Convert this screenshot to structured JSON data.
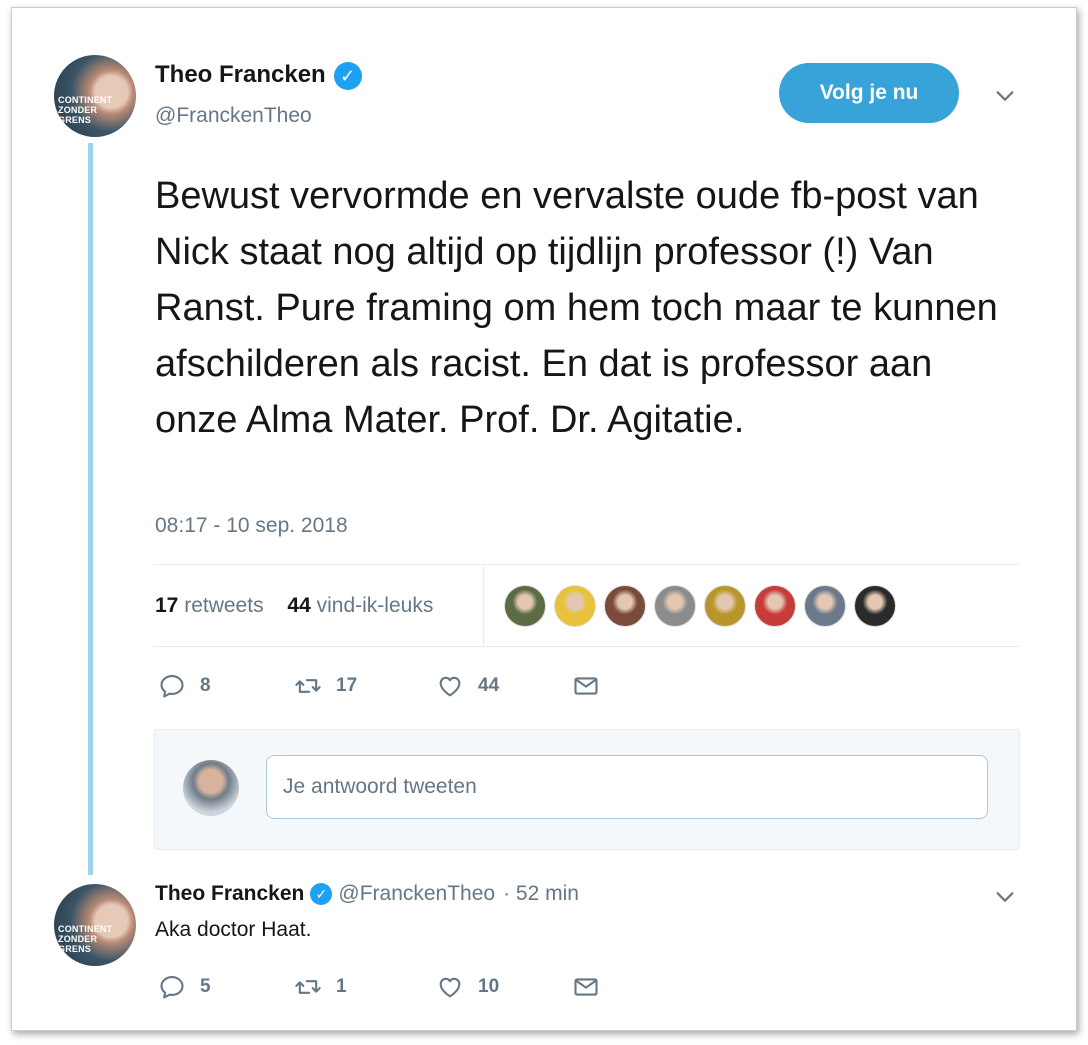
{
  "main_tweet": {
    "author_name": "Theo Francken",
    "author_handle": "@FranckenTheo",
    "avatar_text": "CONTINENT\nZONDER\nGRENS",
    "follow_label": "Volg je nu",
    "text": "Bewust vervormde en vervalste oude fb-post van Nick staat nog altijd op tijdlijn professor (!) Van Ranst. Pure framing om hem toch maar te kunnen afschilderen als racist. En dat is professor aan onze Alma Mater. Prof. Dr. Agitatie.",
    "timestamp": "08:17 - 10 sep. 2018",
    "retweets_count": "17",
    "retweets_label": "retweets",
    "likes_count": "44",
    "likes_label": "vind-ik-leuks",
    "liker_avatar_colors": [
      "#5b6b44",
      "#e8c23a",
      "#7a4a3a",
      "#8c8c8c",
      "#b8962a",
      "#c73b3b",
      "#6a7a8a",
      "#2a2a2a"
    ],
    "actions": {
      "replies": "8",
      "retweets": "17",
      "likes": "44"
    }
  },
  "reply_composer": {
    "placeholder": "Je antwoord tweeten"
  },
  "reply_tweet": {
    "author_name": "Theo Francken",
    "author_handle": "@FranckenTheo",
    "time": "· 52 min",
    "text": "Aka doctor Haat.",
    "actions": {
      "replies": "5",
      "retweets": "1",
      "likes": "10"
    }
  },
  "colors": {
    "accent": "#1da1f2",
    "follow_button": "#37a3d8",
    "thread_line": "#9fd3ec"
  }
}
